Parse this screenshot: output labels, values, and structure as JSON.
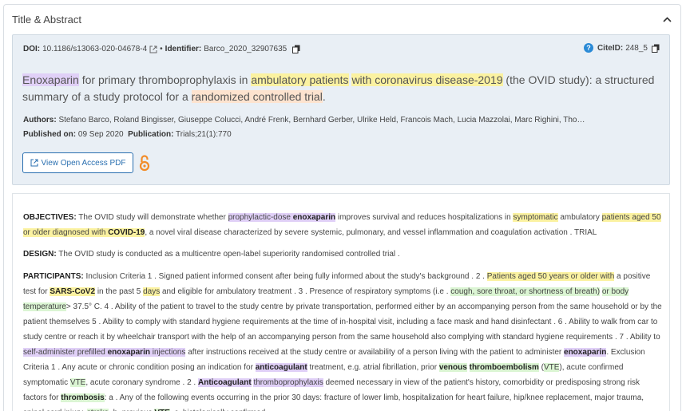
{
  "panel": {
    "title": "Title & Abstract"
  },
  "meta": {
    "doi_label": "DOI:",
    "doi_value": "10.1186/s13063-020-04678-4",
    "identifier_sep": "•",
    "identifier_label": "Identifier:",
    "identifier_value": "Barco_2020_32907635",
    "citeid_label": "CiteID:",
    "citeid_value": "248_5",
    "title_segments": [
      {
        "text": "Enoxaparin",
        "hl": "purple"
      },
      {
        "text": " for primary thromboprophylaxis in ",
        "hl": ""
      },
      {
        "text": "ambulatory patients",
        "hl": "yellow"
      },
      {
        "text": " ",
        "hl": ""
      },
      {
        "text": "with coronavirus disease-2019",
        "hl": "yellow"
      },
      {
        "text": " (the OVID study): a structured summary of a study protocol for a ",
        "hl": ""
      },
      {
        "text": "randomized controlled trial",
        "hl": "orange"
      },
      {
        "text": ".",
        "hl": ""
      }
    ],
    "authors_label": "Authors:",
    "authors_value": "Stefano Barco, Roland Bingisser, Giuseppe Colucci, André Frenk, Bernhard Gerber, Ulrike Held, Francois Mach, Lucia Mazzolai, Marc Righini, Tho…",
    "published_label": "Published on:",
    "published_value": "09 Sep 2020",
    "publication_label": "Publication:",
    "publication_value": "Trials;21(1):770",
    "pdf_button": "View Open Access PDF"
  },
  "abstract": {
    "objectives_label": "OBJECTIVES:",
    "objectives_segments": [
      {
        "text": " The OVID study will demonstrate whether ",
        "hl": ""
      },
      {
        "text": "prophylactic-dose ",
        "hl": "purple"
      },
      {
        "text": "enoxaparin",
        "hl": "purple-bold"
      },
      {
        "text": " improves survival and reduces hospitalizations in ",
        "hl": ""
      },
      {
        "text": "symptomatic",
        "hl": "yellow"
      },
      {
        "text": " ambulatory ",
        "hl": ""
      },
      {
        "text": "patients aged 50 or older diagnosed with ",
        "hl": "yellow"
      },
      {
        "text": "COVID-19",
        "hl": "yellow-bold"
      },
      {
        "text": ", a novel viral disease characterized by severe systemic, pulmonary, and vessel inflammation and coagulation activation . TRIAL",
        "hl": ""
      }
    ],
    "design_label": "DESIGN:",
    "design_text": " The OVID study is conducted as a multicentre open-label superiority randomised controlled trial .",
    "participants_label": "PARTICIPANTS:",
    "participants_segments": [
      {
        "text": " Inclusion Criteria 1 . Signed patient informed consent after being fully informed about the study's background . 2 . ",
        "hl": ""
      },
      {
        "text": "Patients aged 50 years or older with",
        "hl": "yellow"
      },
      {
        "text": " a positive test for ",
        "hl": ""
      },
      {
        "text": "SARS-CoV2",
        "hl": "yellow-bold"
      },
      {
        "text": " in the past 5 ",
        "hl": ""
      },
      {
        "text": "days",
        "hl": "yellow"
      },
      {
        "text": " and eligible for ambulatory treatment . 3 . Presence of respiratory symptoms (i.e . ",
        "hl": ""
      },
      {
        "text": "cough, sore throat, or shortness of breath)",
        "hl": "green"
      },
      {
        "text": " ",
        "hl": ""
      },
      {
        "text": "or body temperature",
        "hl": "green"
      },
      {
        "text": "> 37.5° C. 4 . Ability of the patient to travel to the study centre by private transportation, performed either by an accompanying person from the same household or by the patient themselves 5 . Ability to comply with standard hygiene requirements at the time of in-hospital visit, including a face mask and hand disinfectant . 6 . Ability to walk from car to study centre or reach it by wheelchair transport with the help of an accompanying person from the same household also complying with standard hygiene requirements . 7 . Ability to ",
        "hl": ""
      },
      {
        "text": "self-administer prefilled ",
        "hl": "purple"
      },
      {
        "text": "enoxaparin",
        "hl": "purple-bold"
      },
      {
        "text": " injections",
        "hl": "purple"
      },
      {
        "text": " after instructions received at the study centre or availability of a person living with the patient to administer ",
        "hl": ""
      },
      {
        "text": "enoxaparin",
        "hl": "purple-bold"
      },
      {
        "text": ". Exclusion Criteria 1 . Any acute or chronic condition posing an indication for ",
        "hl": ""
      },
      {
        "text": "anticoagulant",
        "hl": "purple-bold"
      },
      {
        "text": " treatment, e.g. atrial fibrillation, prior ",
        "hl": ""
      },
      {
        "text": "venous",
        "hl": "green-bold"
      },
      {
        "text": " ",
        "hl": ""
      },
      {
        "text": "thromboembolism",
        "hl": "green-bold"
      },
      {
        "text": " (",
        "hl": ""
      },
      {
        "text": "VTE",
        "hl": "green"
      },
      {
        "text": "), acute confirmed symptomatic ",
        "hl": ""
      },
      {
        "text": "VTE",
        "hl": "green"
      },
      {
        "text": ", acute coronary syndrome . 2 . ",
        "hl": ""
      },
      {
        "text": "Anticoagulant",
        "hl": "purple-bold"
      },
      {
        "text": " ",
        "hl": ""
      },
      {
        "text": "thromboprophylaxis",
        "hl": "purple"
      },
      {
        "text": " deemed necessary in view of the patient's history, comorbidity or predisposing strong risk factors for ",
        "hl": ""
      },
      {
        "text": "thrombosis",
        "hl": "green-bold"
      },
      {
        "text": ": a . Any of the following events occurring in the prior 30 days: fracture of lower limb, hospitalization for heart failure, hip/knee replacement, major trauma, spinal cord injury, ",
        "hl": ""
      },
      {
        "text": "stroke",
        "hl": "green"
      },
      {
        "text": ", b. previous ",
        "hl": ""
      },
      {
        "text": "VTE",
        "hl": "green-bold"
      },
      {
        "text": ", c. histologically confirmed",
        "hl": ""
      }
    ]
  },
  "colors": {
    "purple": "#e0d0f7",
    "yellow": "#fbf2a1",
    "green": "#dbf5d3",
    "orange": "#fde3cf",
    "accent": "#2a6fb0"
  },
  "icons": [
    "chevron-up-icon",
    "external-link-icon",
    "copy-icon",
    "help-icon",
    "open-access-icon"
  ]
}
